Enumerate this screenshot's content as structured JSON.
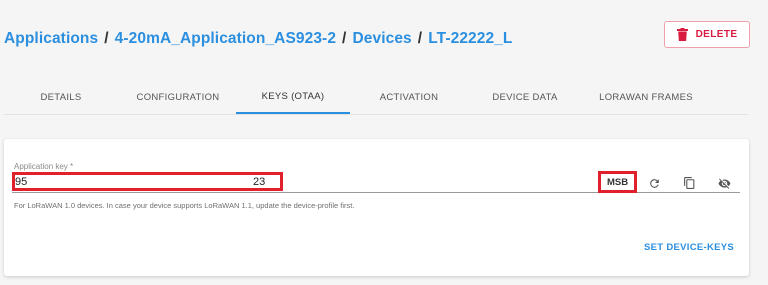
{
  "breadcrumb": {
    "applications": "Applications",
    "application": "4-20mA_Application_AS923-2",
    "devices": "Devices",
    "device": "LT-22222_L",
    "separator": "/"
  },
  "actions": {
    "delete_label": "DELETE"
  },
  "tabs": [
    {
      "label": "DETAILS",
      "active": false
    },
    {
      "label": "CONFIGURATION",
      "active": false
    },
    {
      "label": "KEYS (OTAA)",
      "active": true
    },
    {
      "label": "ACTIVATION",
      "active": false
    },
    {
      "label": "DEVICE DATA",
      "active": false
    },
    {
      "label": "LORAWAN FRAMES",
      "active": false
    }
  ],
  "keys_form": {
    "application_key_label": "Application key *",
    "application_key_value_start": "95",
    "application_key_value_end": "23",
    "byte_order_label": "MSB",
    "helper_text": "For LoRaWAN 1.0 devices. In case your device supports LoRaWAN 1.1, update the device-profile first.",
    "submit_label": "SET DEVICE-KEYS"
  },
  "colors": {
    "accent": "#2b8fe0",
    "danger": "#d81b3f",
    "highlight": "#e0202d"
  }
}
